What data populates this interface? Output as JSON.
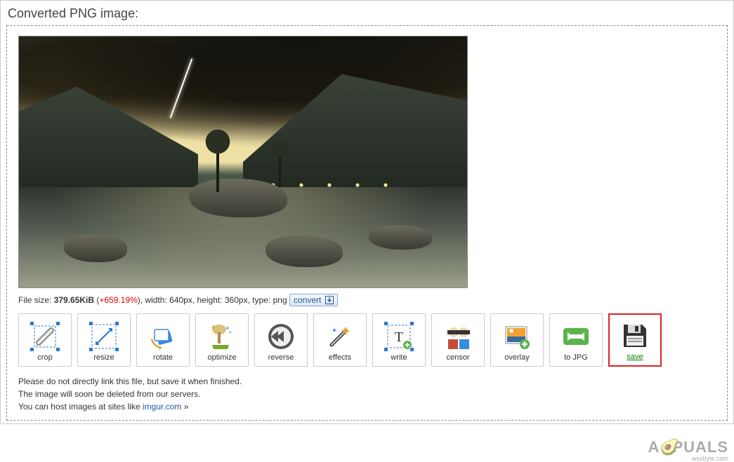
{
  "title": "Converted PNG image:",
  "file": {
    "size_label": "File size: ",
    "size_value": "379.65KiB",
    "delta": "+659.19%",
    "width_label": ", width: 640px",
    "height_label": ", height: 360px",
    "type_label": ", type: png",
    "convert_label": "convert"
  },
  "tools": {
    "crop": "crop",
    "resize": "resize",
    "rotate": "rotate",
    "optimize": "optimize",
    "reverse": "reverse",
    "effects": "effects",
    "write": "write",
    "censor": "censor",
    "overlay": "overlay",
    "to_jpg": "to JPG",
    "save": "save"
  },
  "notes": {
    "l1": "Please do not directly link this file, but save it when finished.",
    "l2": "The image will soon be deleted from our servers.",
    "l3a": "You can host images at sites like ",
    "l3link": "imgur.com",
    "l3b": " »"
  },
  "watermark": "A PUALS",
  "wmsite": "wsxbyte.com"
}
